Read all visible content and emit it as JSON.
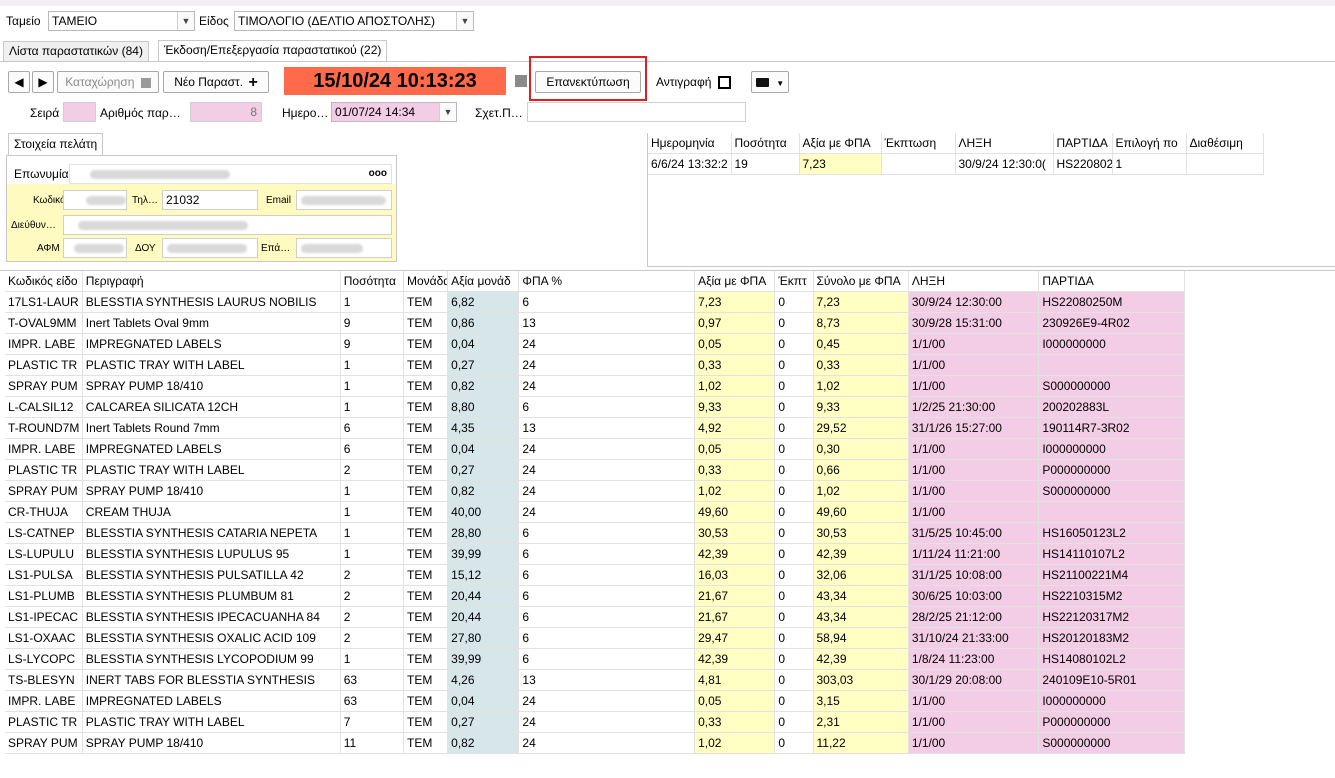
{
  "header": {
    "tameio_label": "Ταμείο",
    "tameio_value": "ΤΑΜΕΙΟ",
    "eidos_label": "Είδος",
    "eidos_value": "ΤΙΜΟΛΟΓΙΟ (ΔΕΛΤΙΟ ΑΠΟΣΤΟΛΗΣ)"
  },
  "tabs": [
    {
      "label": "Λίστα παραστατικών (84)"
    },
    {
      "label": "Έκδοση/Επεξεργασία παραστατικού (22)"
    }
  ],
  "toolbar": {
    "prev_icon": "◀",
    "next_icon": "▶",
    "save_label": "Καταχώρηση",
    "new_label": "Νέο Παραστ.",
    "datetime": "15/10/24 10:13:23",
    "reprint_label": "Επανεκτύπωση",
    "copy_label": "Αντιγραφή",
    "print_icon": "printer-icon",
    "accent_color": "#ff6b4a",
    "highlight_color": "#e31d1d"
  },
  "docfields": {
    "seira_label": "Σειρά",
    "arithmos_label": "Αριθμός παρ…",
    "arithmos_value": "8",
    "imerominia_label": "Ημερο…",
    "imerominia_value": "01/07/24 14:34",
    "sxet_label": "Σχετ.Π…"
  },
  "customer": {
    "tab_label": "Στοιχεία πελάτη",
    "eponymia_label": "Επωνυμία",
    "dots": "ooo",
    "kodikos_label": "Κωδικός",
    "til_label": "Τηλ…",
    "til_value": "21032",
    "email_label": "Email",
    "dieuth_label": "Διεύθυν…",
    "afm_label": "ΑΦΜ",
    "doy_label": "ΔΟΥ",
    "epa_label": "Επά…"
  },
  "stock": {
    "headers": [
      "Ημερομηνία",
      "Ποσότητα",
      "Αξία με ΦΠΑ",
      "Έκπτωση",
      "ΛΗΞΗ",
      "ΠΑΡΤΙΔΑ",
      "Επιλογή πο",
      "Διαθέσιμη"
    ],
    "row": [
      "6/6/24 13:32:2",
      "19",
      "7,23",
      "",
      "30/9/24 12:30:0(",
      "HS220802",
      "1",
      ""
    ]
  },
  "lines": {
    "headers": [
      "Κωδικός είδο",
      "Περιγραφή",
      "Ποσότητα",
      "Μονάδα",
      "Αξία μονάδ",
      "ΦΠΑ %",
      "Αξία με ΦΠΑ",
      "Έκπτ",
      "Σύνολο με ΦΠΑ",
      "ΛΗΞΗ",
      "ΠΑΡΤΙΔΑ"
    ],
    "rows": [
      [
        "17LS1-LAUR",
        "BLESSTIA SYNTHESIS LAURUS NOBILIS",
        "1",
        "TEM",
        "6,82",
        "6",
        "7,23",
        "0",
        "7,23",
        "30/9/24 12:30:00",
        "HS22080250M"
      ],
      [
        "T-OVAL9MM",
        "Inert Tablets Oval 9mm",
        "9",
        "TEM",
        "0,86",
        "13",
        "0,97",
        "0",
        "8,73",
        "30/9/28 15:31:00",
        "230926E9-4R02"
      ],
      [
        "IMPR. LABE",
        "IMPREGNATED LABELS",
        "9",
        "TEM",
        "0,04",
        "24",
        "0,05",
        "0",
        "0,45",
        "1/1/00",
        "I000000000"
      ],
      [
        "PLASTIC TR",
        "PLASTIC TRAY WITH LABEL",
        "1",
        "TEM",
        "0,27",
        "24",
        "0,33",
        "0",
        "0,33",
        "1/1/00",
        ""
      ],
      [
        "SPRAY PUM",
        "SPRAY PUMP 18/410",
        "1",
        "TEM",
        "0,82",
        "24",
        "1,02",
        "0",
        "1,02",
        "1/1/00",
        "S000000000"
      ],
      [
        "L-CALSIL12",
        "CALCAREA SILICATA 12CH",
        "1",
        "TEM",
        "8,80",
        "6",
        "9,33",
        "0",
        "9,33",
        "1/2/25 21:30:00",
        "200202883L"
      ],
      [
        "T-ROUND7M",
        "Inert Tablets Round 7mm",
        "6",
        "TEM",
        "4,35",
        "13",
        "4,92",
        "0",
        "29,52",
        "31/1/26 15:27:00",
        "190114R7-3R02"
      ],
      [
        "IMPR. LABE",
        "IMPREGNATED LABELS",
        "6",
        "TEM",
        "0,04",
        "24",
        "0,05",
        "0",
        "0,30",
        "1/1/00",
        "I000000000"
      ],
      [
        "PLASTIC TR",
        "PLASTIC TRAY WITH LABEL",
        "2",
        "TEM",
        "0,27",
        "24",
        "0,33",
        "0",
        "0,66",
        "1/1/00",
        "P000000000"
      ],
      [
        "SPRAY PUM",
        "SPRAY PUMP 18/410",
        "1",
        "TEM",
        "0,82",
        "24",
        "1,02",
        "0",
        "1,02",
        "1/1/00",
        "S000000000"
      ],
      [
        "CR-THUJA",
        "CREAM THUJA",
        "1",
        "TEM",
        "40,00",
        "24",
        "49,60",
        "0",
        "49,60",
        "1/1/00",
        ""
      ],
      [
        "LS-CATNEP",
        "BLESSTIA SYNTHESIS CATARIA NEPETA",
        "1",
        "TEM",
        "28,80",
        "6",
        "30,53",
        "0",
        "30,53",
        "31/5/25 10:45:00",
        "HS16050123L2"
      ],
      [
        "LS-LUPULU",
        "BLESSTIA SYNTHESIS LUPULUS 95",
        "1",
        "TEM",
        "39,99",
        "6",
        "42,39",
        "0",
        "42,39",
        "1/11/24 11:21:00",
        "HS14110107L2"
      ],
      [
        "LS1-PULSA",
        "BLESSTIA SYNTHESIS PULSATILLA 42",
        "2",
        "TEM",
        "15,12",
        "6",
        "16,03",
        "0",
        "32,06",
        "31/1/25 10:08:00",
        "HS21100221M4"
      ],
      [
        "LS1-PLUMB",
        "BLESSTIA SYNTHESIS PLUMBUM 81",
        "2",
        "TEM",
        "20,44",
        "6",
        "21,67",
        "0",
        "43,34",
        "30/6/25 10:03:00",
        "HS2210315M2"
      ],
      [
        "LS1-IPECAC",
        "BLESSTIA SYNTHESIS IPECACUANHA 84",
        "2",
        "TEM",
        "20,44",
        "6",
        "21,67",
        "0",
        "43,34",
        "28/2/25 21:12:00",
        "HS22120317M2"
      ],
      [
        "LS1-OXAAC",
        "BLESSTIA SYNTHESIS OXALIC ACID 109",
        "2",
        "TEM",
        "27,80",
        "6",
        "29,47",
        "0",
        "58,94",
        "31/10/24 21:33:00",
        "HS20120183M2"
      ],
      [
        "LS-LYCOPC",
        "BLESSTIA SYNTHESIS LYCOPODIUM 99",
        "1",
        "TEM",
        "39,99",
        "6",
        "42,39",
        "0",
        "42,39",
        "1/8/24 11:23:00",
        "HS14080102L2"
      ],
      [
        "TS-BLESYN",
        "INERT TABS FOR BLESSTIA SYNTHESIS",
        "63",
        "TEM",
        "4,26",
        "13",
        "4,81",
        "0",
        "303,03",
        "30/1/29 20:08:00",
        "240109E10-5R01"
      ],
      [
        "IMPR. LABE",
        "IMPREGNATED LABELS",
        "63",
        "TEM",
        "0,04",
        "24",
        "0,05",
        "0",
        "3,15",
        "1/1/00",
        "I000000000"
      ],
      [
        "PLASTIC TR",
        "PLASTIC TRAY WITH LABEL",
        "7",
        "TEM",
        "0,27",
        "24",
        "0,33",
        "0",
        "2,31",
        "1/1/00",
        "P000000000"
      ],
      [
        "SPRAY PUM",
        "SPRAY PUMP 18/410",
        "11",
        "TEM",
        "0,82",
        "24",
        "1,02",
        "0",
        "11,22",
        "1/1/00",
        "S000000000"
      ]
    ]
  }
}
